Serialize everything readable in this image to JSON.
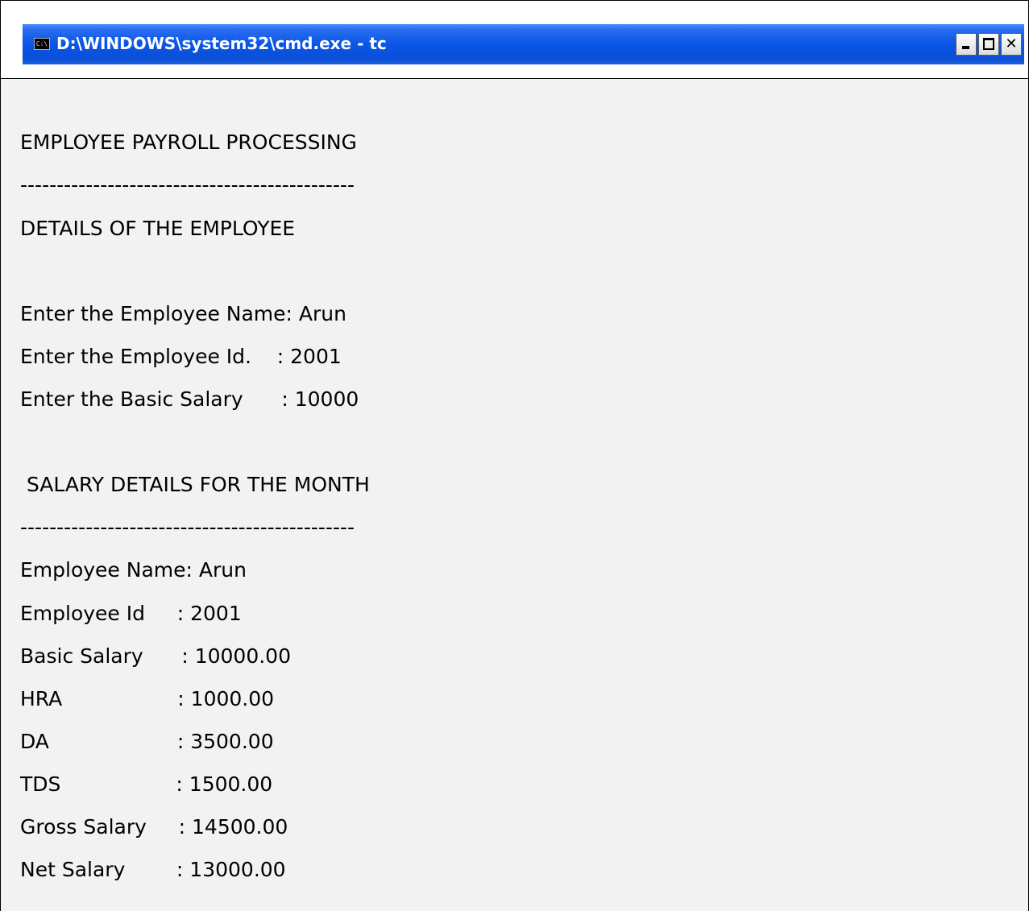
{
  "window": {
    "title": "D:\\WINDOWS\\system32\\cmd.exe - tc",
    "icon_label": "C:\\",
    "icon": "cmd-icon",
    "buttons": {
      "minimize_icon": "minimize-icon",
      "maximize_icon": "maximize-icon",
      "close_icon": "close-icon",
      "close_glyph": "✕"
    },
    "titlebar_color": "#0a55e6"
  },
  "console": {
    "heading": "EMPLOYEE PAYROLL PROCESSING",
    "separator_1": "----------------------------------------------",
    "details_heading": "DETAILS OF THE EMPLOYEE",
    "input_name": "Enter the Employee Name: Arun",
    "input_id": "Enter the Employee Id.    : 2001",
    "input_salary": "Enter the Basic Salary      : 10000",
    "salary_heading": " SALARY DETAILS FOR THE MONTH",
    "separator_2": "----------------------------------------------",
    "out_name": "Employee Name: Arun",
    "out_id": "Employee Id     : 2001",
    "out_basic": "Basic Salary      : 10000.00",
    "out_hra": "HRA                  : 1000.00",
    "out_da": "DA                    : 3500.00",
    "out_tds": "TDS                  : 1500.00",
    "out_gross": "Gross Salary     : 14500.00",
    "out_net": "Net Salary        : 13000.00"
  }
}
